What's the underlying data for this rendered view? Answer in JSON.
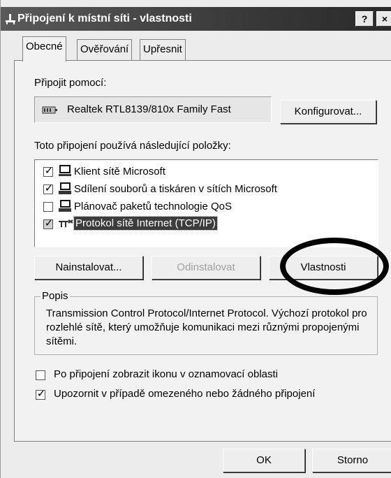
{
  "window": {
    "title": "Připojení k místní síti - vlastnosti",
    "help_button": "?",
    "close_button": "×"
  },
  "tabs": [
    {
      "label": "Obecné",
      "active": true
    },
    {
      "label": "Ověřování",
      "active": false
    },
    {
      "label": "Upřesnit",
      "active": false
    }
  ],
  "connect_using": {
    "label": "Připojit pomocí:",
    "adapter": "Realtek RTL8139/810x Family Fast",
    "configure_button": "Konfigurovat..."
  },
  "components": {
    "label": "Toto připojení používá následující položky:",
    "items": [
      {
        "label": "Klient sítě Microsoft",
        "checked": true,
        "icon": "network-client-icon"
      },
      {
        "label": "Sdílení souborů a tiskáren v sítích Microsoft",
        "checked": true,
        "icon": "network-service-icon"
      },
      {
        "label": "Plánovač paketů technologie QoS",
        "checked": false,
        "icon": "network-service-icon"
      },
      {
        "label": "Protokol sítě Internet (TCP/IP)",
        "checked": true,
        "selected": true,
        "icon": "network-protocol-icon"
      }
    ]
  },
  "buttons": {
    "install": "Nainstalovat...",
    "uninstall": "Odinstalovat",
    "properties": "Vlastnosti",
    "ok": "OK",
    "cancel": "Storno"
  },
  "description": {
    "legend": "Popis",
    "text": "Transmission Control Protocol/Internet Protocol. Výchozí protokol pro rozlehlé sítě, který umožňuje komunikaci mezi různými propojenými sítěmi."
  },
  "options": [
    {
      "label": "Po připojení zobrazit ikonu v oznamovací oblasti",
      "checked": false
    },
    {
      "label": "Upozornit v případě omezeného nebo žádného připojení",
      "checked": true
    }
  ],
  "annotation": {
    "color": "#000000",
    "shape": "ellipse around Vlastnosti button"
  }
}
